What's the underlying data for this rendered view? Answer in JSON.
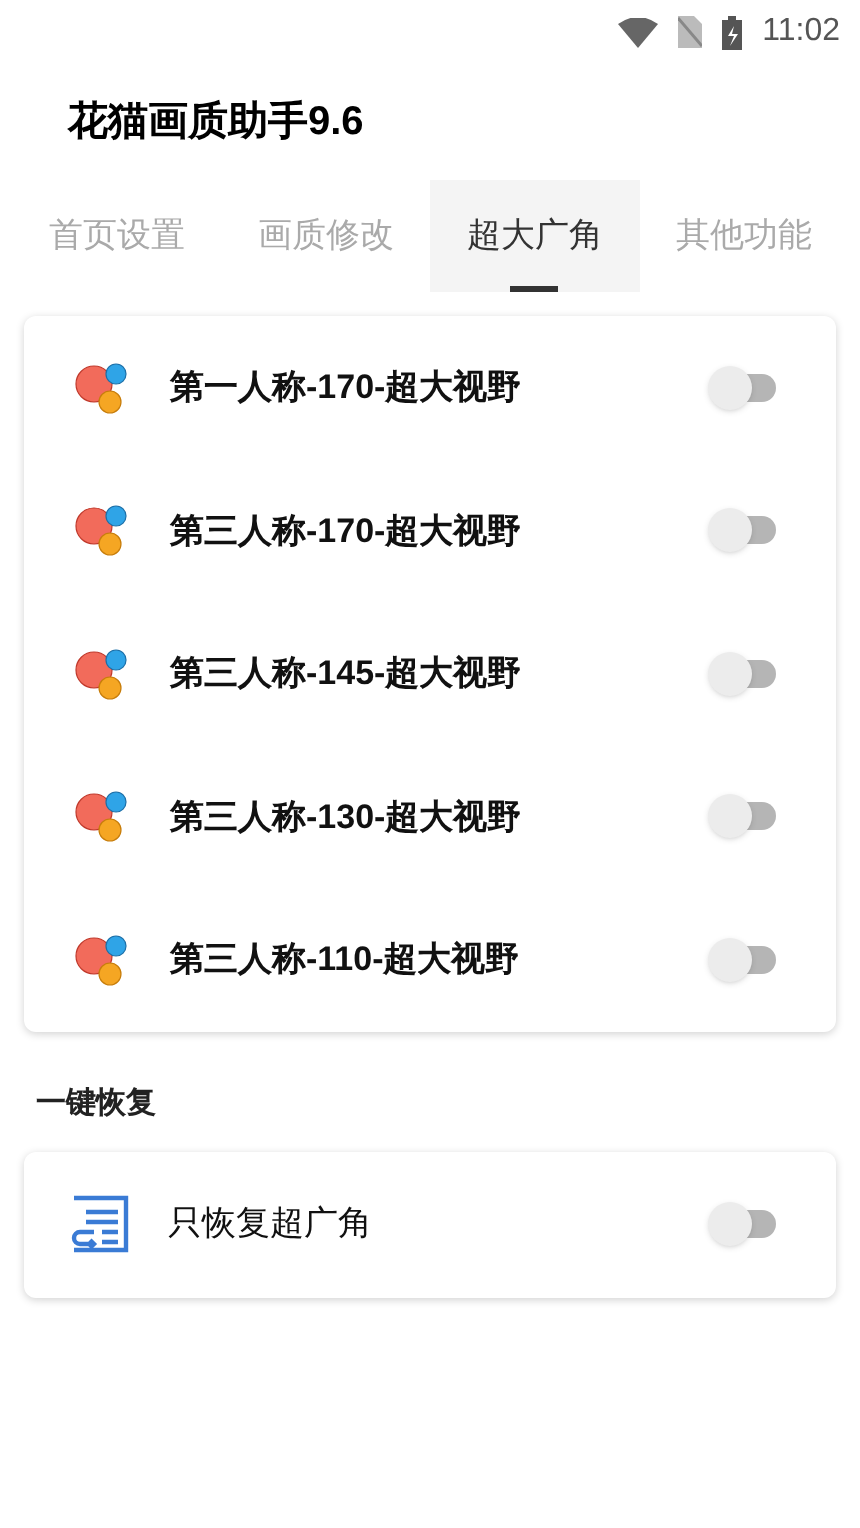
{
  "status_bar": {
    "time": "11:02"
  },
  "app_title": "花猫画质助手9.6",
  "tabs": [
    {
      "label": "首页设置",
      "selected": false
    },
    {
      "label": "画质修改",
      "selected": false
    },
    {
      "label": "超大广角",
      "selected": true
    },
    {
      "label": "其他功能",
      "selected": false
    }
  ],
  "options": [
    {
      "label": "第一人称-170-超大视野",
      "on": false
    },
    {
      "label": "第三人称-170-超大视野",
      "on": false
    },
    {
      "label": "第三人称-145-超大视野",
      "on": false
    },
    {
      "label": "第三人称-130-超大视野",
      "on": false
    },
    {
      "label": "第三人称-110-超大视野",
      "on": false
    }
  ],
  "restore_section": {
    "title": "一键恢复",
    "items": [
      {
        "label": "只恢复超广角",
        "on": false
      }
    ]
  }
}
